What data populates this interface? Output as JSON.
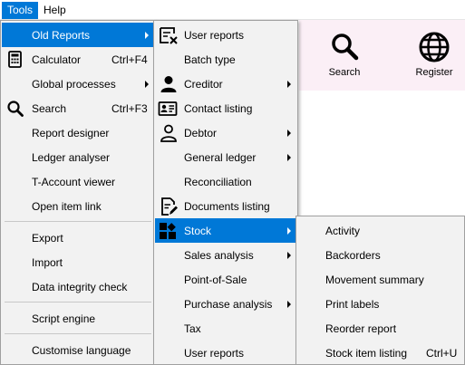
{
  "menubar": {
    "tools": "Tools",
    "help": "Help"
  },
  "toolbar": {
    "search": "Search",
    "register": "Register"
  },
  "tools_menu": {
    "old_reports": "Old Reports",
    "calculator": "Calculator",
    "calculator_shortcut": "Ctrl+F4",
    "global_processes": "Global processes",
    "search": "Search",
    "search_shortcut": "Ctrl+F3",
    "report_designer": "Report designer",
    "ledger_analyser": "Ledger analyser",
    "taccount_viewer": "T-Account viewer",
    "open_item_link": "Open item link",
    "export": "Export",
    "import": "Import",
    "data_integrity": "Data integrity check",
    "script_engine": "Script engine",
    "customise_language": "Customise language"
  },
  "old_reports_menu": {
    "user_reports": "User reports",
    "batch_type": "Batch type",
    "creditor": "Creditor",
    "contact_listing": "Contact listing",
    "debtor": "Debtor",
    "general_ledger": "General ledger",
    "reconciliation": "Reconciliation",
    "documents_listing": "Documents listing",
    "stock": "Stock",
    "sales_analysis": "Sales analysis",
    "point_of_sale": "Point-of-Sale",
    "purchase_analysis": "Purchase analysis",
    "tax": "Tax",
    "user_reports_2": "User reports"
  },
  "stock_menu": {
    "activity": "Activity",
    "backorders": "Backorders",
    "movement_summary": "Movement summary",
    "print_labels": "Print labels",
    "reorder_report": "Reorder report",
    "stock_item_listing": "Stock item listing",
    "stock_item_listing_shortcut": "Ctrl+U"
  }
}
